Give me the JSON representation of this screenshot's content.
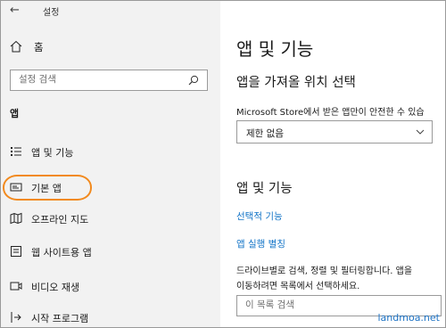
{
  "window": {
    "title": "설정",
    "back_symbol": "←"
  },
  "sidebar": {
    "home_label": "홈",
    "search_placeholder": "설정 검색",
    "section_title": "앱",
    "items": [
      {
        "label": "앱 및 기능",
        "icon": "apps-list-icon"
      },
      {
        "label": "기본 앱",
        "icon": "default-apps-icon"
      },
      {
        "label": "오프라인 지도",
        "icon": "offline-maps-icon"
      },
      {
        "label": "웹 사이트용 앱",
        "icon": "web-apps-icon"
      },
      {
        "label": "비디오 재생",
        "icon": "video-icon"
      },
      {
        "label": "시작 프로그램",
        "icon": "startup-icon"
      }
    ]
  },
  "main": {
    "title": "앱 및 기능",
    "install_heading": "앱을 가져올 위치 선택",
    "install_desc": "Microsoft Store에서 받은 앱만이 안전한 수 있습",
    "install_dropdown_value": "제한 없음",
    "apps_heading": "앱 및 기능",
    "optional_features_link": "선택적 기능",
    "aliases_link": "앱 실행 별칭",
    "search_desc_line1": "드라이브별로 검색, 정렬 및 필터링합니다. 앱을",
    "search_desc_line2": "이동하려면 목록에서 선택하세요.",
    "list_search_placeholder": "이 목록 검색"
  },
  "watermark": "landmoa.net",
  "colors": {
    "accent": "#f28a1e",
    "link": "#1173c7",
    "sidebar_bg": "#f2f2f2"
  }
}
